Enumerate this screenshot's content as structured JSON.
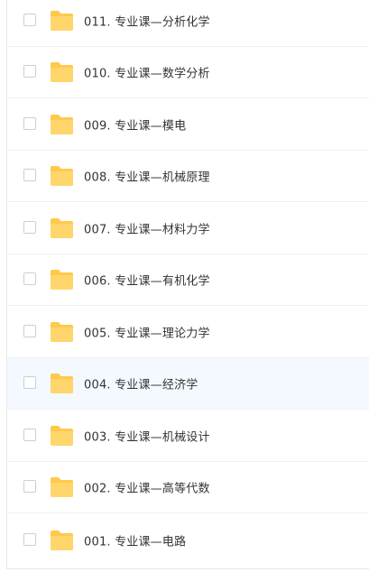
{
  "list": {
    "items": [
      {
        "name": "011. 专业课—分析化学"
      },
      {
        "name": "010. 专业课—数学分析"
      },
      {
        "name": "009. 专业课—模电"
      },
      {
        "name": "008. 专业课—机械原理"
      },
      {
        "name": "007. 专业课—材料力学"
      },
      {
        "name": "006. 专业课—有机化学"
      },
      {
        "name": "005. 专业课—理论力学"
      },
      {
        "name": "004. 专业课—经济学"
      },
      {
        "name": "003. 专业课—机械设计"
      },
      {
        "name": "002. 专业课—高等代数"
      },
      {
        "name": "001. 专业课—电路"
      }
    ],
    "highlighted_index": 7,
    "item_icon": "folder-icon"
  },
  "colors": {
    "folder": "#ffd66b",
    "folder_tab": "#ffc94a",
    "highlight_row": "#f4f9ff",
    "text": "#333333"
  }
}
